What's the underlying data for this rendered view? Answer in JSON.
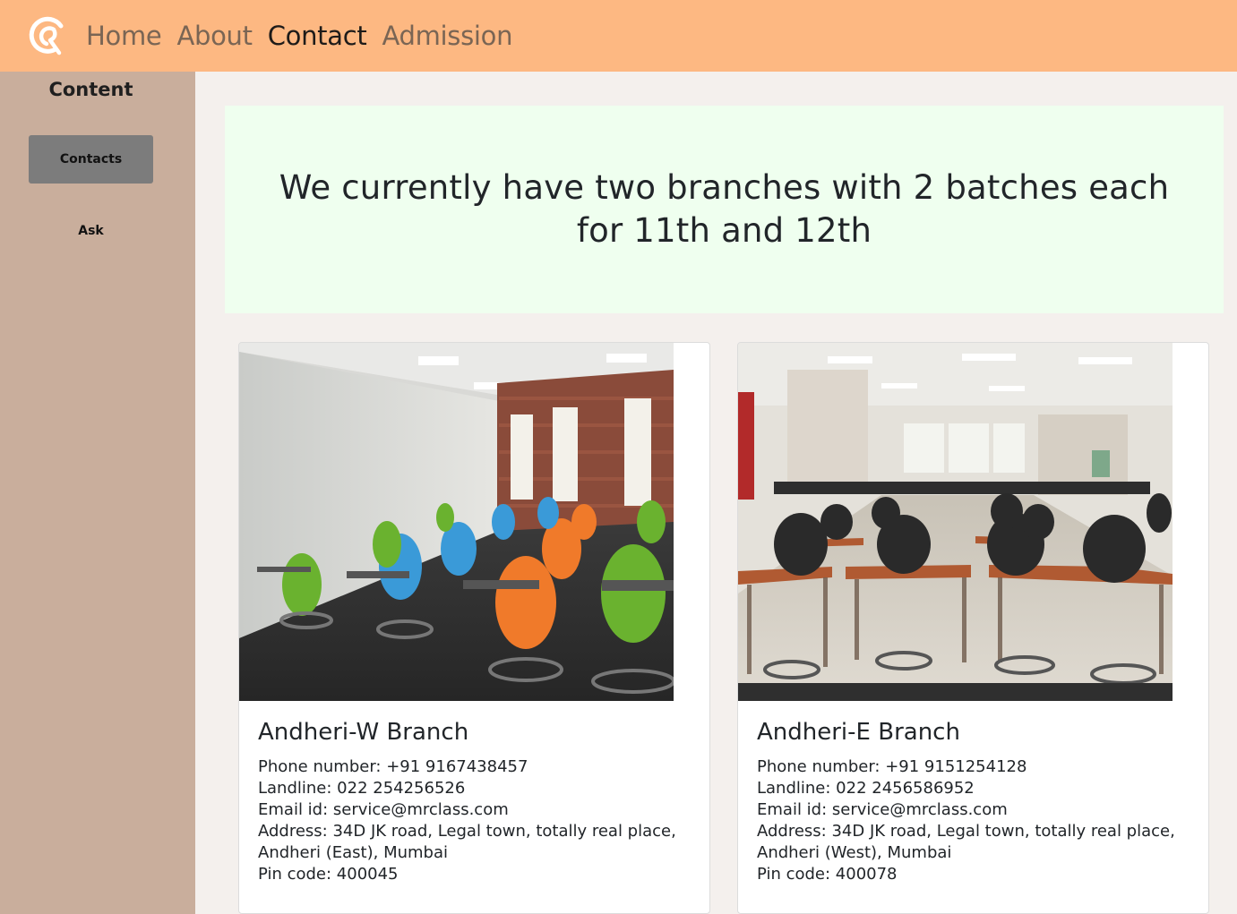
{
  "nav": {
    "links": [
      {
        "label": "Home",
        "active": false
      },
      {
        "label": "About",
        "active": false
      },
      {
        "label": "Contact",
        "active": true
      },
      {
        "label": "Admission",
        "active": false
      }
    ]
  },
  "sidebar": {
    "title": "Content",
    "items": [
      {
        "label": "Contacts",
        "selected": true
      },
      {
        "label": "Ask",
        "selected": false
      }
    ]
  },
  "hero": {
    "text": "We currently have two branches with 2 batches each for 11th and 12th"
  },
  "branches": [
    {
      "title": "Andheri-W Branch",
      "image": "classroom-colorful-chairs",
      "phone": "Phone number: +91 9167438457",
      "landline": "Landline: 022 254256526",
      "email": "Email id: service@mrclass.com",
      "address1": "Address: 34D JK road, Legal town, totally real place,",
      "address2": "Andheri (East), Mumbai",
      "pin": "Pin code: 400045"
    },
    {
      "title": "Andheri-E Branch",
      "image": "science-lab-classroom",
      "phone": "Phone number: +91 9151254128",
      "landline": "Landline: 022 2456586952",
      "email": "Email id: service@mrclass.com",
      "address1": "Address: 34D JK road, Legal town, totally real place,",
      "address2": "Andheri (West), Mumbai",
      "pin": "Pin code: 400078"
    }
  ],
  "colors": {
    "navbar": "#fdb882",
    "sidebar": "#c9ae9c",
    "hero": "#efffef",
    "page": "#f4f0ed"
  }
}
